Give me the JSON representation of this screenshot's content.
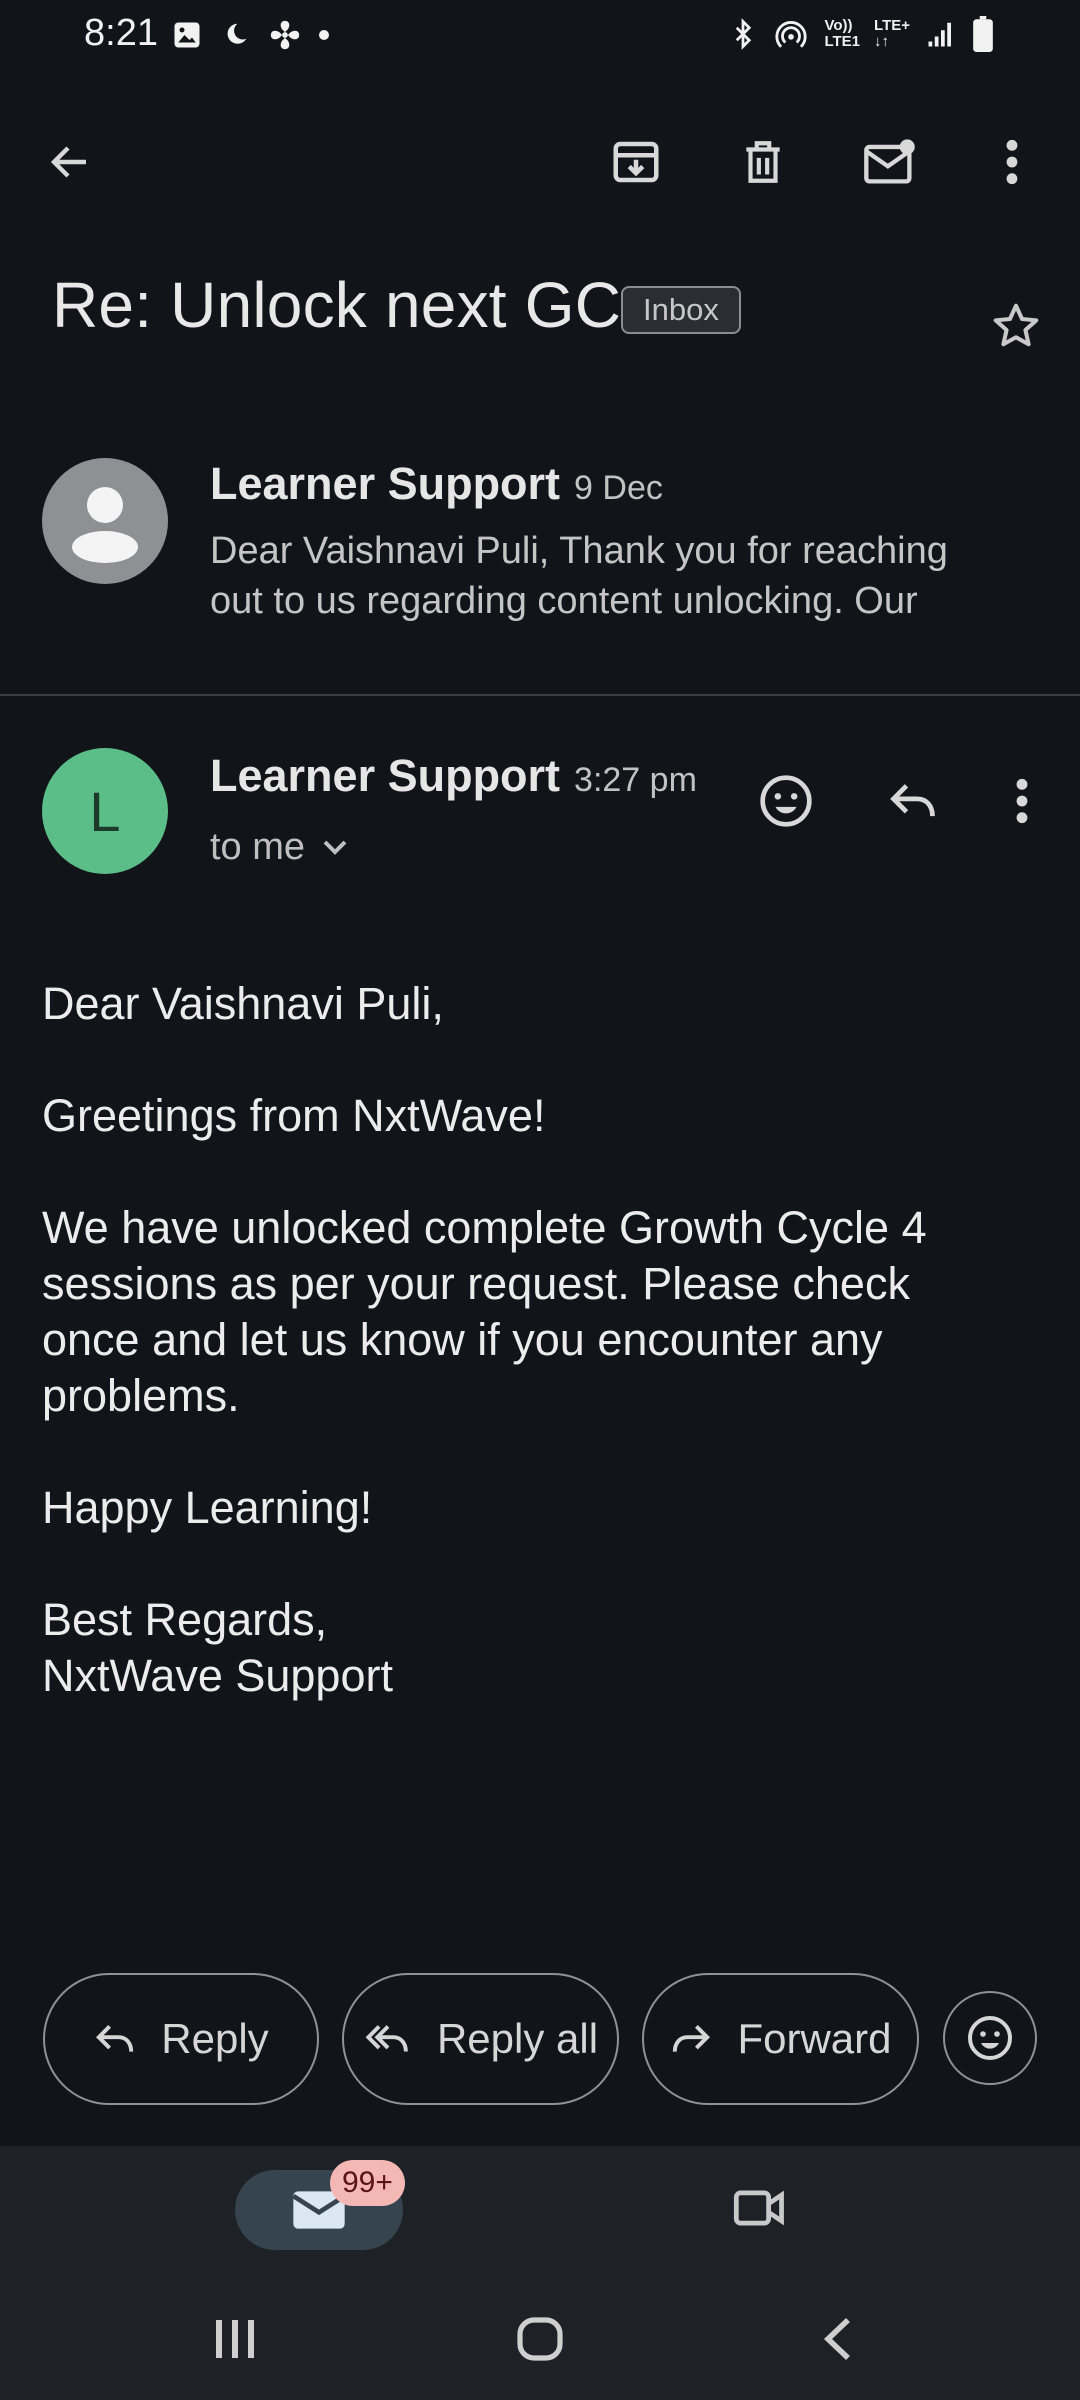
{
  "status_bar": {
    "time": "8:21",
    "network_top": "LTE+",
    "network_left": "Vo))",
    "network_left2": "LTE1"
  },
  "app_bar": {
    "back": "back-arrow-icon",
    "archive": "archive-icon",
    "delete": "delete-icon",
    "mark_unread": "mark-unread-icon",
    "more": "more-vert-icon"
  },
  "subject": {
    "title": "Re: Unlock next GC",
    "label": "Inbox"
  },
  "earlier_message": {
    "sender": "Learner Support",
    "date": "9 Dec",
    "snippet_line1": "Dear Vaishnavi Puli, Thank you for reaching",
    "snippet_line2": "out to us regarding content unlocking. Our"
  },
  "message": {
    "avatar_letter": "L",
    "sender": "Learner Support",
    "time": "3:27 pm",
    "recipient": "to me",
    "body": {
      "greeting": "Dear Vaishnavi Puli,",
      "line_greetings": "Greetings from NxtWave!",
      "para1_line1": "We have unlocked complete Growth Cycle 4",
      "para1_line2": "sessions as per your request. Please check",
      "para1_line3": "once and let us know if you encounter any",
      "para1_line4": "problems.",
      "happy": "Happy Learning!",
      "regards": "Best Regards,",
      "signature": "NxtWave Support"
    }
  },
  "actions": {
    "reply": "Reply",
    "reply_all": "Reply all",
    "forward": "Forward"
  },
  "bottom_nav": {
    "mail_badge": "99+"
  },
  "colors": {
    "background": "#111418",
    "avatar_green": "#5bbd87",
    "avatar_grey": "#8e9094",
    "badge": "#f3b8b4"
  }
}
